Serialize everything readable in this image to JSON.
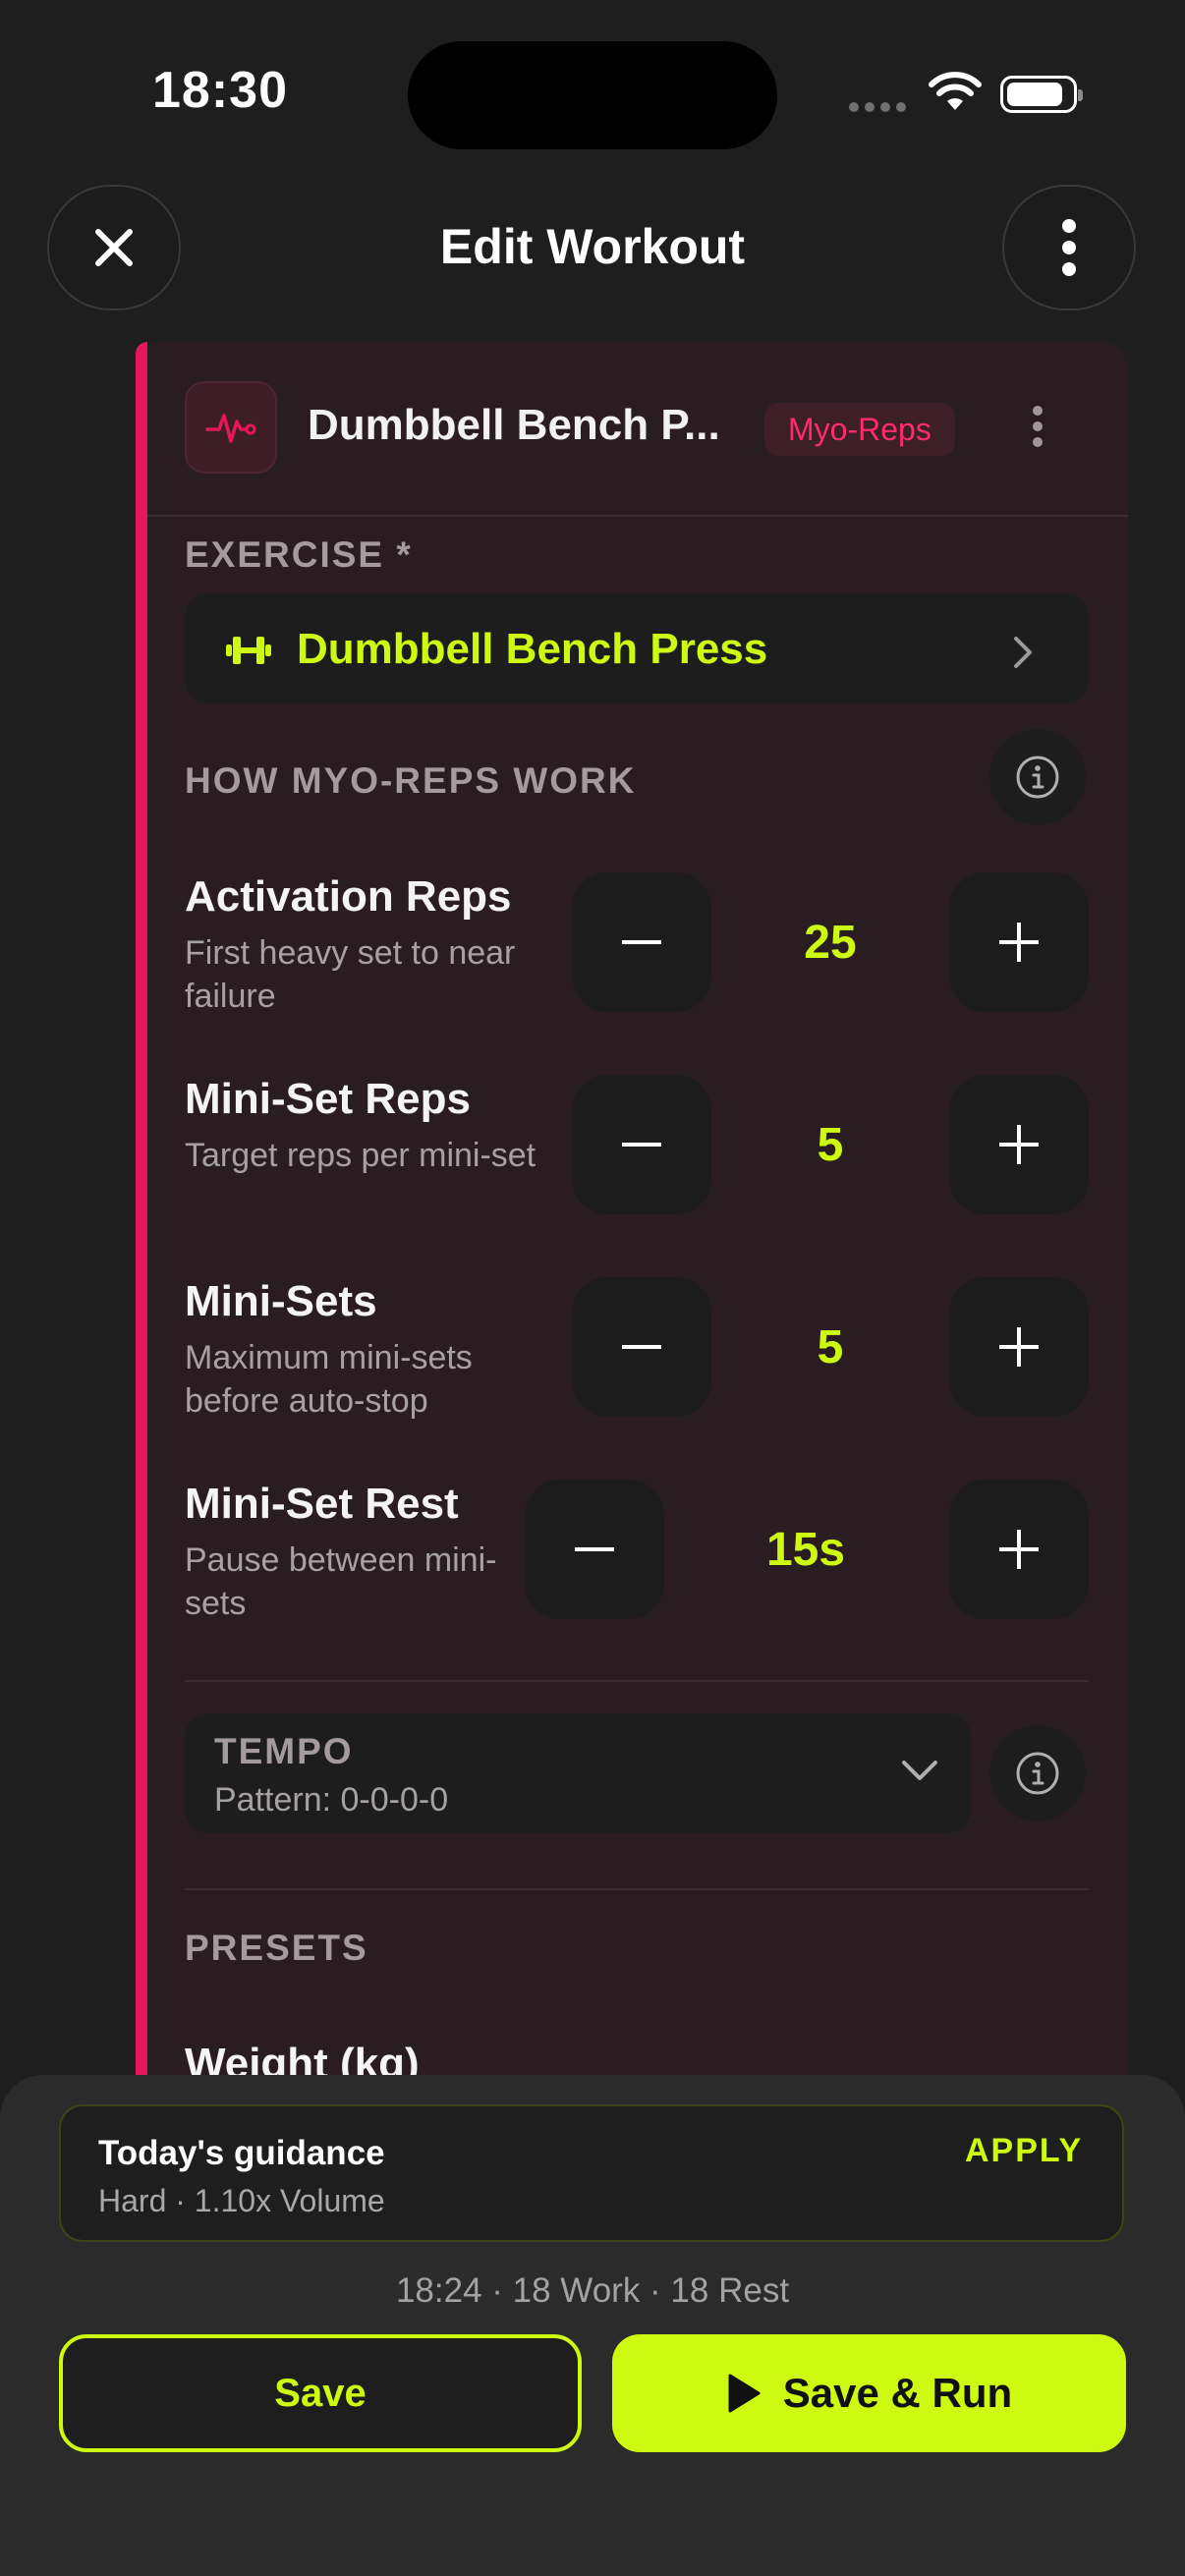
{
  "status_bar": {
    "time": "18:30"
  },
  "header": {
    "title": "Edit Workout",
    "close_icon": "close-icon",
    "more_icon": "more-vertical-icon"
  },
  "block": {
    "title": "Dumbbell Bench P...",
    "badge": "Myo-Reps",
    "accent_color": "#e5175a",
    "icon": "pulse-icon"
  },
  "exercise": {
    "label": "EXERCISE *",
    "name": "Dumbbell Bench Press",
    "icon": "dumbbell-icon"
  },
  "how_it_works": {
    "label": "HOW MYO-REPS WORK"
  },
  "params": [
    {
      "title": "Activation Reps",
      "desc": "First heavy set to near failure",
      "value": "25"
    },
    {
      "title": "Mini-Set Reps",
      "desc": "Target reps per mini-set",
      "value": "5"
    },
    {
      "title": "Mini-Sets",
      "desc": "Maximum mini-sets before auto-stop",
      "value": "5"
    },
    {
      "title": "Mini-Set Rest",
      "desc": "Pause between mini-sets",
      "value": "15s"
    }
  ],
  "tempo": {
    "label": "TEMPO",
    "pattern": "Pattern: 0-0-0-0"
  },
  "presets": {
    "label": "PRESETS",
    "weight_label": "Weight (kg)"
  },
  "guidance": {
    "title": "Today's guidance",
    "subtitle": "Hard · 1.10x Volume",
    "apply_label": "APPLY"
  },
  "summary": "18:24  ·  18 Work  ·  18 Rest",
  "actions": {
    "save_label": "Save",
    "run_label": "Save & Run"
  },
  "colors": {
    "accent": "#cdfa10",
    "background": "#1e1e1f",
    "card": "#2a1d21",
    "badge": "#ff2b6a"
  }
}
